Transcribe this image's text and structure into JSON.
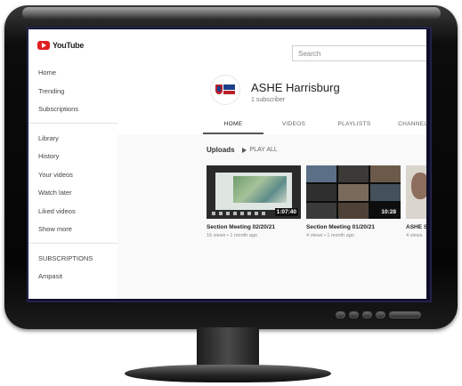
{
  "app": {
    "logo_text": "YouTube",
    "search_placeholder": "Search"
  },
  "sidebar": {
    "group1": [
      {
        "label": "Home",
        "icon": "home-icon"
      },
      {
        "label": "Trending",
        "icon": "trending-icon"
      },
      {
        "label": "Subscriptions",
        "icon": "subscriptions-icon"
      }
    ],
    "group2": [
      {
        "label": "Library",
        "icon": "library-icon"
      },
      {
        "label": "History",
        "icon": "history-icon"
      },
      {
        "label": "Your videos",
        "icon": "your-videos-icon"
      },
      {
        "label": "Watch later",
        "icon": "watch-later-icon"
      },
      {
        "label": "Liked videos",
        "icon": "liked-videos-icon"
      },
      {
        "label": "Show more",
        "icon": "chevron-down-icon"
      }
    ],
    "group3": [
      {
        "label": "SUBSCRIPTIONS"
      },
      {
        "label": "Ampasit"
      }
    ]
  },
  "channel": {
    "name": "ASHE Harrisburg",
    "subscribers": "1 subscriber",
    "tabs": [
      "HOME",
      "VIDEOS",
      "PLAYLISTS",
      "CHANNELS"
    ],
    "active_tab": "HOME"
  },
  "uploads": {
    "label": "Uploads",
    "play_all": "PLAY ALL"
  },
  "videos": [
    {
      "title": "Section Meeting 02/20/21",
      "meta": "16 views • 1 month ago",
      "duration": "1:07:40"
    },
    {
      "title": "Section Meeting 01/20/21",
      "meta": "4 views • 1 month ago",
      "duration": "10:28"
    },
    {
      "title": "ASHE S",
      "meta": "4 views",
      "duration": ""
    }
  ],
  "colors": {
    "brand_red": "#e02020",
    "ashe_blue": "#1c3f8a",
    "ashe_red": "#b8202a",
    "monitor_black": "#050505"
  }
}
